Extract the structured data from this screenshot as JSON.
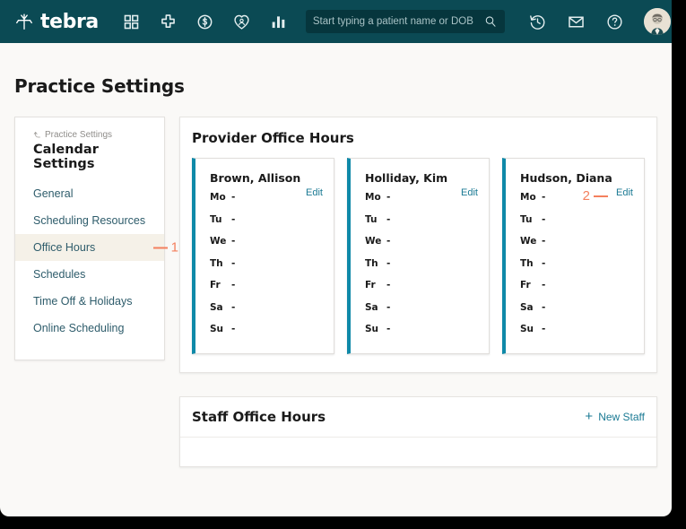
{
  "topnav": {
    "brand": "tebra",
    "brand_icon": "tebra-leaf-logo",
    "icons": [
      {
        "name": "dashboard-grid-icon",
        "label": "Dashboard"
      },
      {
        "name": "medical-cross-icon",
        "label": "Clinical"
      },
      {
        "name": "dollar-circle-icon",
        "label": "Billing"
      },
      {
        "name": "heart-patient-icon",
        "label": "Patients"
      },
      {
        "name": "bar-chart-icon",
        "label": "Reports"
      }
    ],
    "search": {
      "placeholder": "Start typing a patient name or DOB",
      "value": "",
      "icon": "search-icon"
    },
    "right_icons": [
      {
        "name": "history-clock-icon",
        "label": "Recent"
      },
      {
        "name": "envelope-icon",
        "label": "Messages"
      },
      {
        "name": "help-question-icon",
        "label": "Help"
      }
    ],
    "avatar": {
      "name": "user-avatar",
      "label": "Account"
    }
  },
  "page": {
    "title": "Practice Settings"
  },
  "sidebar": {
    "breadcrumb": {
      "icon": "back-arrow-icon",
      "label": "Practice Settings"
    },
    "heading": "Calendar Settings",
    "items": [
      {
        "label": "General",
        "active": false
      },
      {
        "label": "Scheduling Resources",
        "active": false
      },
      {
        "label": "Office Hours",
        "active": true
      },
      {
        "label": "Schedules",
        "active": false
      },
      {
        "label": "Time Off & Holidays",
        "active": false
      },
      {
        "label": "Online Scheduling",
        "active": false
      }
    ]
  },
  "provider_panel": {
    "title": "Provider Office Hours",
    "edit_label": "Edit",
    "days": [
      "Mo",
      "Tu",
      "We",
      "Th",
      "Fr",
      "Sa",
      "Su"
    ],
    "providers": [
      {
        "name": "Brown, Allison",
        "hours": [
          "-",
          "-",
          "-",
          "-",
          "-",
          "-",
          "-"
        ]
      },
      {
        "name": "Holliday, Kim",
        "hours": [
          "-",
          "-",
          "-",
          "-",
          "-",
          "-",
          "-"
        ]
      },
      {
        "name": "Hudson, Diana",
        "hours": [
          "-",
          "-",
          "-",
          "-",
          "-",
          "-",
          "-"
        ]
      }
    ]
  },
  "staff_panel": {
    "title": "Staff Office Hours",
    "new_staff_label": "New Staff",
    "new_staff_icon": "plus-icon",
    "rows": []
  },
  "annotations": [
    {
      "id": "1",
      "number": "1",
      "target": "Office Hours sidebar item"
    },
    {
      "id": "2",
      "number": "2",
      "target": "Edit link on Hudson, Diana card"
    }
  ],
  "colors": {
    "nav_background": "#0B4A54",
    "page_background": "#FAF9F7",
    "card_accent": "#0F89A8",
    "link": "#1B7A94",
    "annotation": "#F4805E",
    "active_item_background": "#F5F1E8"
  }
}
